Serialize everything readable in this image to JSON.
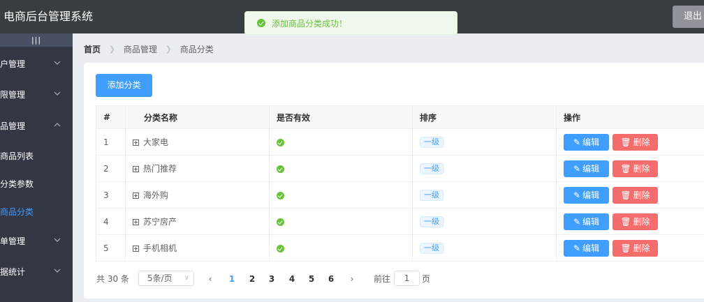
{
  "app": {
    "title": "电商后台管理系统",
    "logout_label": "退出"
  },
  "toast": {
    "message": "添加商品分类成功！",
    "icon": "check-circle-icon"
  },
  "sidebar": {
    "toggle": "|||",
    "items": [
      {
        "label": "户管理",
        "icon": "chevron-down-icon"
      },
      {
        "label": "限管理",
        "icon": "chevron-down-icon"
      },
      {
        "label": "品管理",
        "icon": "chevron-up-icon"
      },
      {
        "label": "单管理",
        "icon": "chevron-down-icon"
      },
      {
        "label": "据统计",
        "icon": "chevron-down-icon"
      }
    ],
    "subitems": [
      {
        "label": "商品列表",
        "active": false
      },
      {
        "label": "分类参数",
        "active": false
      },
      {
        "label": "商品分类",
        "active": true
      }
    ]
  },
  "breadcrumb": [
    "首页",
    "商品管理",
    "商品分类"
  ],
  "page": {
    "add_button": "添加分类"
  },
  "table": {
    "columns": [
      "#",
      "分类名称",
      "是否有效",
      "排序",
      "操作"
    ],
    "rows": [
      {
        "index": "1",
        "name": "大家电",
        "valid": true,
        "level": "一级"
      },
      {
        "index": "2",
        "name": "热门推荐",
        "valid": true,
        "level": "一级"
      },
      {
        "index": "3",
        "name": "海外购",
        "valid": true,
        "level": "一级"
      },
      {
        "index": "4",
        "name": "苏宁房产",
        "valid": true,
        "level": "一级"
      },
      {
        "index": "5",
        "name": "手机相机",
        "valid": true,
        "level": "一级"
      }
    ],
    "actions": {
      "edit": "编辑",
      "delete": "删除"
    }
  },
  "pagination": {
    "total": "共 30 条",
    "page_size": "5条/页",
    "pages": [
      "1",
      "2",
      "3",
      "4",
      "5",
      "6"
    ],
    "current": "1",
    "goto_label": "前往",
    "goto_value": "1",
    "page_suffix": "页"
  },
  "colors": {
    "primary": "#409eff",
    "danger": "#f56c6c",
    "success": "#67c23a",
    "header": "#373d41",
    "sidebar": "#333744"
  }
}
